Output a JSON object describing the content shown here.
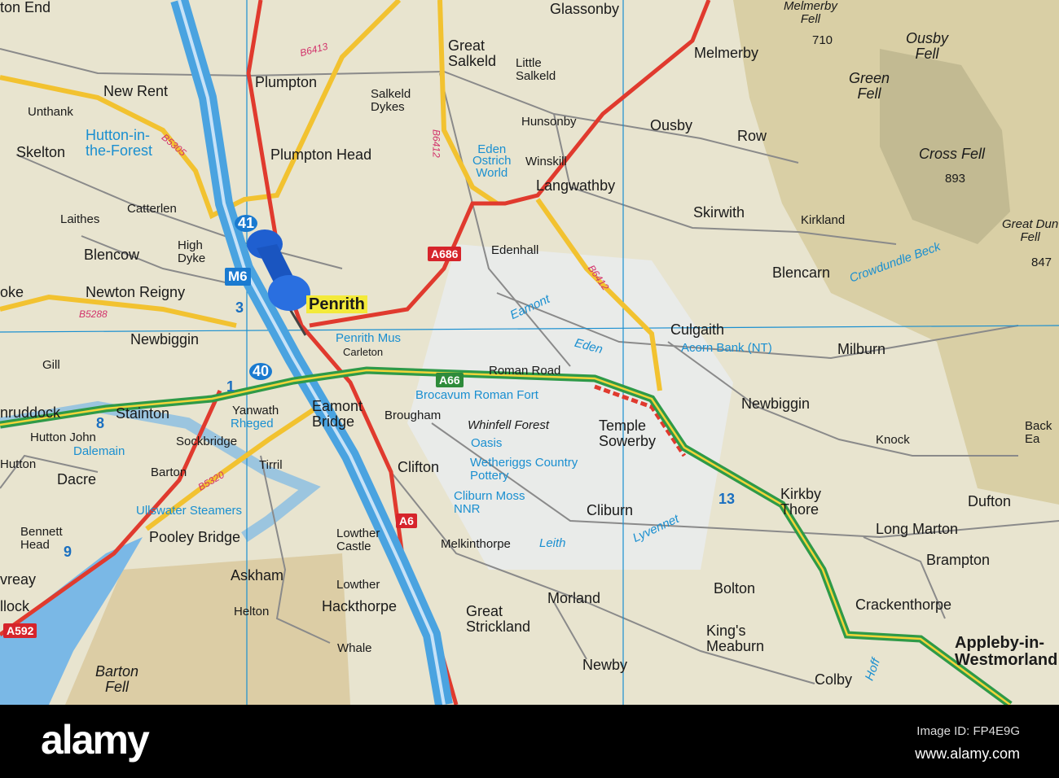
{
  "places": {
    "ton_end": "ton End",
    "glassonby": "Glassonby",
    "great_salkeld": "Great\nSalkeld",
    "little_salkeld": "Little\nSalkeld",
    "melmerby": "Melmerby",
    "plumpton": "Plumpton",
    "new_rent": "New Rent",
    "unthank": "Unthank",
    "salkeld_dykes": "Salkeld\nDykes",
    "hunsonby": "Hunsonby",
    "ousby": "Ousby",
    "row": "Row",
    "skelton": "Skelton",
    "plumpton_head": "Plumpton Head",
    "winskill": "Winskill",
    "langwathby": "Langwathby",
    "catterlen": "Catterlen",
    "laithes": "Laithes",
    "skirwith": "Skirwith",
    "kirkland": "Kirkland",
    "high_dyke": "High\nDyke",
    "blencow": "Blencow",
    "edenhall": "Edenhall",
    "blencarn": "Blencarn",
    "oke": "oke",
    "newton_reigny": "Newton Reigny",
    "penrith": "Penrith",
    "newbiggin_w": "Newbiggin",
    "culgaith": "Culgaith",
    "milburn": "Milburn",
    "carleton": "Carleton",
    "gill": "Gill",
    "roman_road": "Roman Road",
    "eamont_bridge": "Eamont\nBridge",
    "newbiggin_e": "Newbiggin",
    "nruddock": "nruddock",
    "stainton": "Stainton",
    "yanwath": "Yanwath",
    "brougham": "Brougham",
    "temple_sowerby": "Temple\nSowerby",
    "back_ea": "Back\nEa",
    "hutton_john": "Hutton John",
    "sockbridge": "Sockbridge",
    "knock": "Knock",
    "hutton": "Hutton",
    "tirril": "Tirril",
    "clifton": "Clifton",
    "barton": "Barton",
    "dacre": "Dacre",
    "kirkby_thore": "Kirkby\nThore",
    "dufton": "Dufton",
    "cliburn": "Cliburn",
    "bennett_head": "Bennett\nHead",
    "pooley_bridge": "Pooley Bridge",
    "lowther_castle": "Lowther\nCastle",
    "long_marton": "Long Marton",
    "melkinthorpe": "Melkinthorpe",
    "brampton": "Brampton",
    "askham": "Askham",
    "bolton": "Bolton",
    "vreay": "vreay",
    "lowther": "Lowther",
    "hackthorpe": "Hackthorpe",
    "morland": "Morland",
    "great_strickland": "Great\nStrickland",
    "crackenthorpe": "Crackenthorpe",
    "llock": "llock",
    "helton": "Helton",
    "kings_meaburn": "King's\nMeaburn",
    "appleby": "Appleby-in-\nWestmorland",
    "whale": "Whale",
    "newby": "Newby",
    "colby": "Colby"
  },
  "fells": {
    "melmerby_fell": "Melmerby\nFell",
    "melmerby_fell_h": "710",
    "ousby_fell": "Ousby\nFell",
    "green_fell": "Green\nFell",
    "cross_fell": "Cross Fell",
    "cross_fell_h": "893",
    "great_dun_fell": "Great Dun\nFell",
    "great_dun_fell_h": "847",
    "whinfell_forest": "Whinfell Forest",
    "barton_fell": "Barton\nFell"
  },
  "attractions": {
    "hutton_forest": "Hutton-in-\nthe-Forest",
    "eden_ostrich": "Eden\nOstrich\nWorld",
    "penrith_mus": "Penrith Mus",
    "acorn_bank": "Acorn Bank (NT)",
    "brocavum": "Brocavum Roman Fort",
    "rheged": "Rheged",
    "oasis": "Oasis",
    "dalemain": "Dalemain",
    "wetheriggs": "Wetheriggs Country\nPottery",
    "cliburn_moss": "Cliburn Moss\nNNR",
    "ullswater": "Ullswater Steamers"
  },
  "rivers": {
    "crowdundle": "Crowdundle Beck",
    "eamont": "Eamont",
    "eden": "Eden",
    "leith": "Leith",
    "lyvennet": "Lyvennet",
    "hoff": "Hoff"
  },
  "roads": {
    "b6413": "B6413",
    "b5305": "B5305",
    "b6412a": "B6412",
    "b6412b": "B6412",
    "b5288": "B5288",
    "b5320": "B5320",
    "a686": "A686",
    "a66": "A66",
    "a6": "A6",
    "a592": "A592",
    "m6": "M6"
  },
  "junctions": {
    "j41": "41",
    "j40": "40",
    "j3": "3",
    "j1": "1",
    "j8": "8",
    "j9": "9",
    "j13": "13"
  },
  "footer": {
    "logo": "alamy",
    "image_id": "Image ID: FP4E9G",
    "site": "www.alamy.com"
  },
  "colors": {
    "land": "#e8e4cf",
    "motorway": "#4aa3e0",
    "a_road": "#e03a2e",
    "b_road": "#f2c230",
    "primary": "#2e9a48",
    "water": "#7ab8e6"
  }
}
